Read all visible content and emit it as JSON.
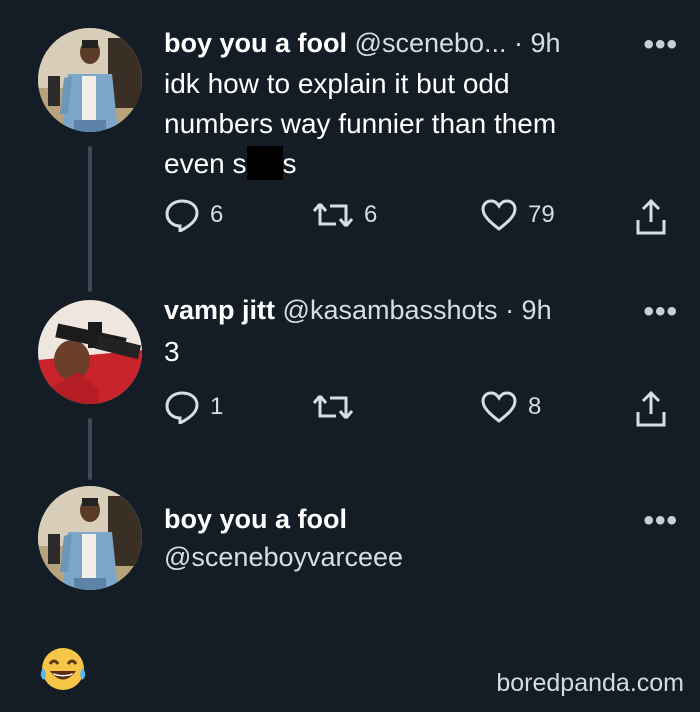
{
  "tweets": [
    {
      "name": "boy you a fool",
      "handle": "@scenebo...",
      "time": "· 9h",
      "more": "•••",
      "lines": [
        "idk how to explain it but odd",
        "numbers way funnier than them"
      ],
      "line3_before": "even s",
      "line3_after": "s",
      "reply_count": "6",
      "retweet_count": "6",
      "like_count": "79"
    },
    {
      "name": "vamp jitt",
      "handle": "@kasambasshots",
      "time": "· 9h",
      "more": "•••",
      "text": "3",
      "reply_count": "1",
      "retweet_count": "",
      "like_count": "8"
    },
    {
      "name": "boy you a fool",
      "handle": "@sceneboyvarceee",
      "more": "•••"
    }
  ],
  "watermark": "boredpanda.com",
  "icons": {
    "reply": "reply-icon",
    "retweet": "retweet-icon",
    "like": "heart-icon",
    "share": "share-icon",
    "emoji": "laughing-crying-emoji"
  },
  "colors": {
    "background": "#141d26",
    "text": "#ffffff",
    "muted": "#d7dde3"
  }
}
